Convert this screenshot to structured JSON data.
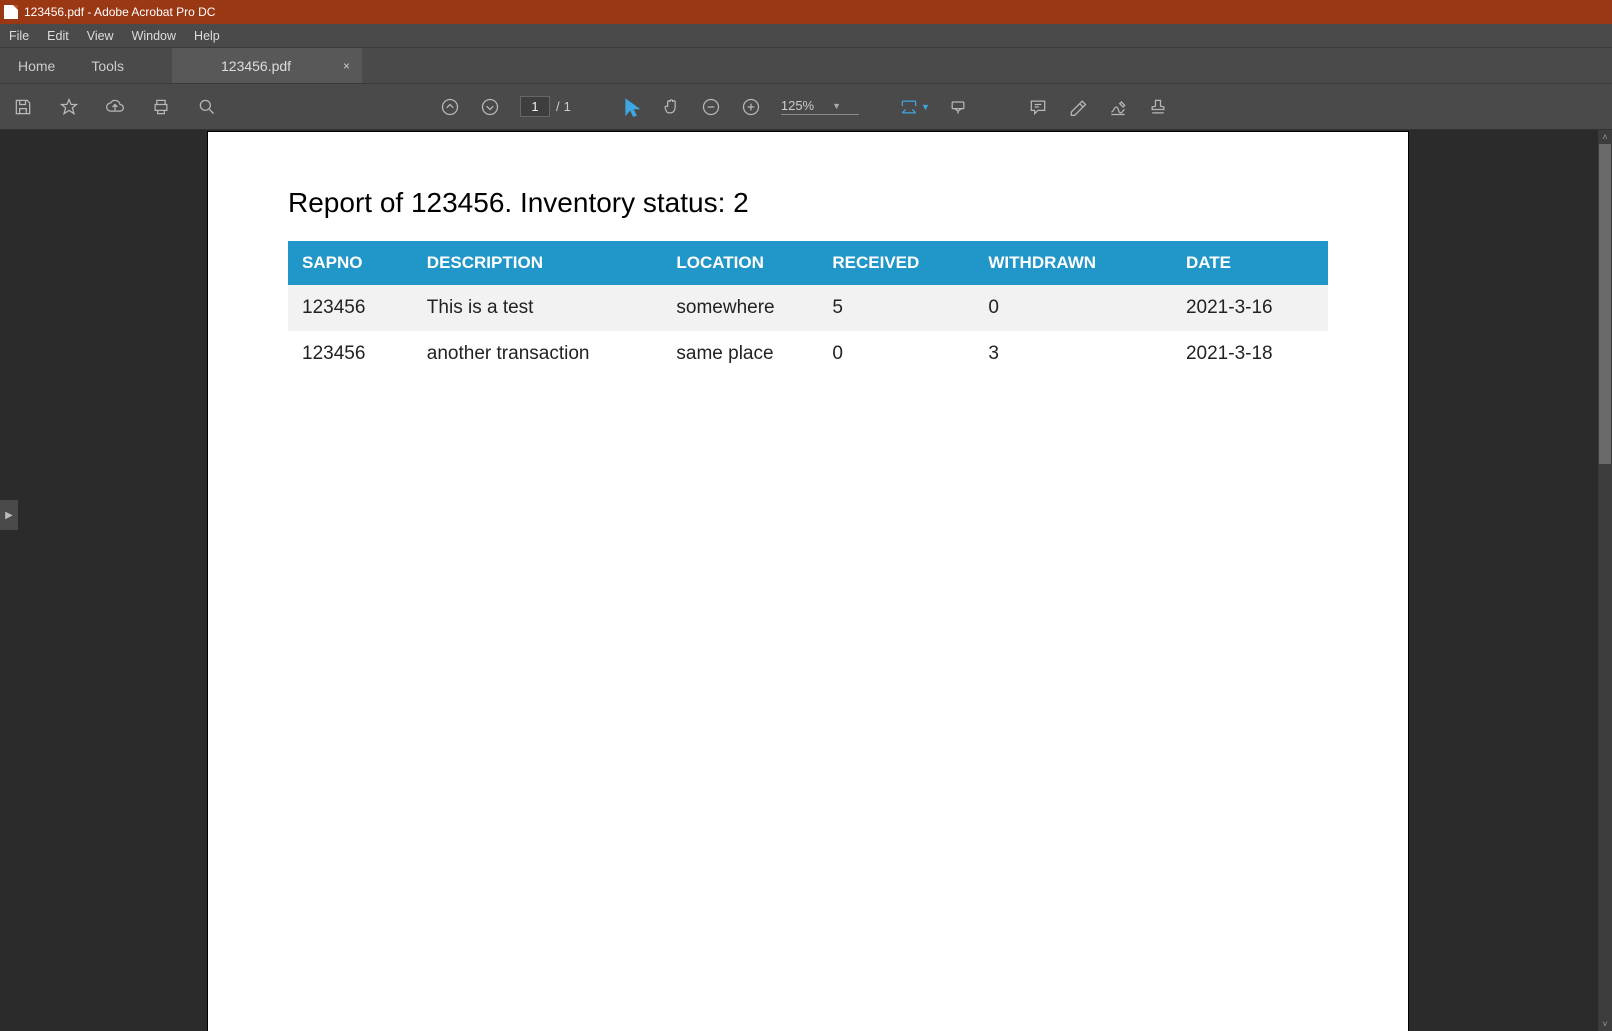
{
  "window": {
    "title": "123456.pdf - Adobe Acrobat Pro DC"
  },
  "menu": {
    "file": "File",
    "edit": "Edit",
    "view": "View",
    "window": "Window",
    "help": "Help"
  },
  "tabs": {
    "home": "Home",
    "tools": "Tools",
    "doc": "123456.pdf",
    "close": "×"
  },
  "toolbar": {
    "page_current": "1",
    "page_sep": "/",
    "page_total": "1",
    "zoom": "125%"
  },
  "document": {
    "title": "Report of 123456. Inventory status: 2",
    "headers": {
      "sapno": "SAPNO",
      "description": "DESCRIPTION",
      "location": "LOCATION",
      "received": "RECEIVED",
      "withdrawn": "WITHDRAWN",
      "date": "DATE"
    },
    "rows": [
      {
        "sapno": "123456",
        "description": "This is a test",
        "location": "somewhere",
        "received": "5",
        "withdrawn": "0",
        "date": "2021-3-16"
      },
      {
        "sapno": "123456",
        "description": "another transaction",
        "location": "same place",
        "received": "0",
        "withdrawn": "3",
        "date": "2021-3-18"
      }
    ]
  },
  "side": {
    "expand": "▶"
  },
  "scroll": {
    "up": "˄",
    "down": "˅"
  }
}
